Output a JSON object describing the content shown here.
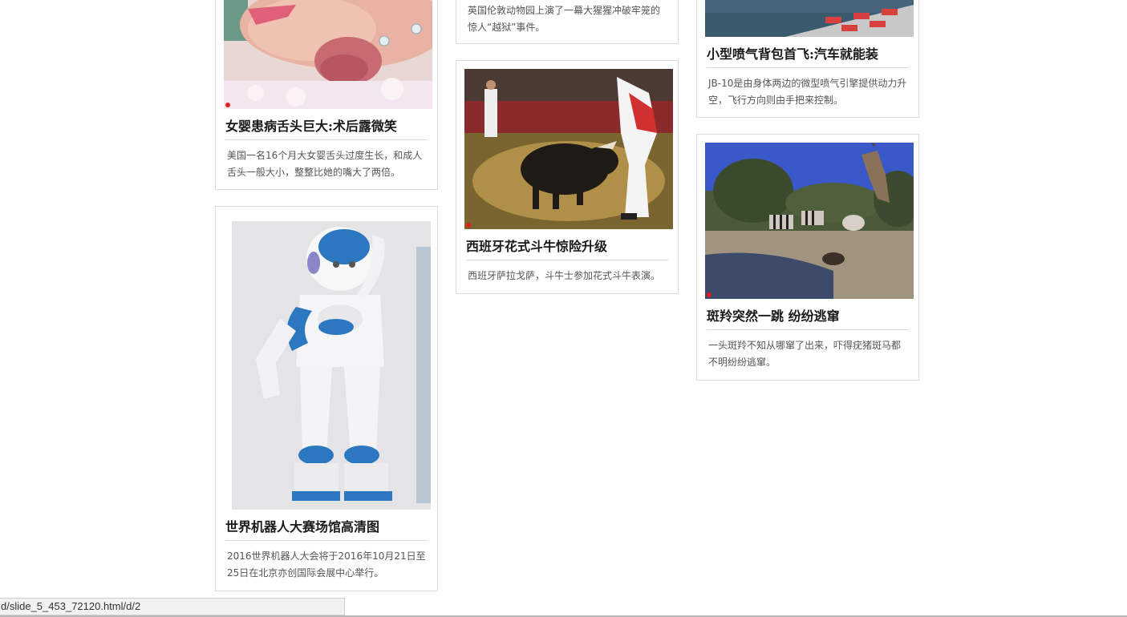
{
  "cards": {
    "c1": {
      "title": "女婴患病舌头巨大:术后露微笑",
      "desc": "美国一名16个月大女婴舌头过度生长，和成人舌头一般大小，整整比她的嘴大了两倍。"
    },
    "c2": {
      "title": "世界机器人大赛场馆高清图",
      "desc": "2016世界机器人大会将于2016年10月21日至25日在北京亦创国际会展中心举行。"
    },
    "c3": {
      "desc": "英国伦敦动物园上演了一幕大猩猩冲破牢笼的惊人“越狱”事件。"
    },
    "c4": {
      "title": "西班牙花式斗牛惊险升级",
      "desc": "西班牙萨拉戈萨，斗牛士参加花式斗牛表演。"
    },
    "c5": {
      "title": "小型喷气背包首飞:汽车就能装",
      "desc": "JB-10是由身体两边的微型喷气引擎提供动力升空，飞行方向则由手把来控制。"
    },
    "c6": {
      "title": "斑羚突然一跳 纷纷逃窜",
      "desc": "一头斑羚不知从哪窜了出来，吓得疣猪斑马都不明纷纷逃窜。"
    }
  },
  "status_bar": {
    "url": "d/slide_5_453_72120.html/d/2"
  }
}
